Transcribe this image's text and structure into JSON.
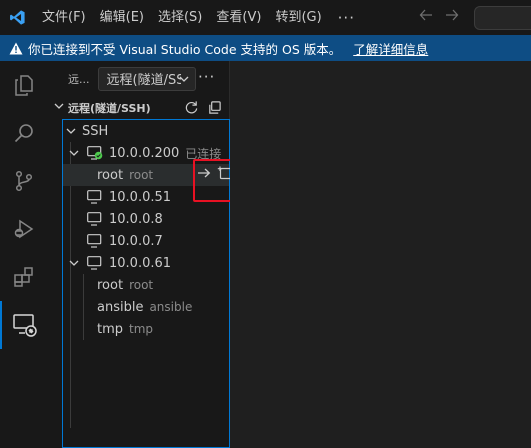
{
  "titlebar": {
    "menu": [
      "文件(F)",
      "编辑(E)",
      "选择(S)",
      "查看(V)",
      "转到(G)"
    ],
    "more": "···"
  },
  "banner": {
    "message": "你已连接到不受 Visual Studio Code 支持的 OS 版本。",
    "link": "了解详细信息"
  },
  "sidebar": {
    "title": "远...",
    "select_value": "远程(隧道/SSH)",
    "more": "···",
    "section_title": "远程(隧道/SSH)"
  },
  "tree": {
    "root_label": "SSH",
    "host1": {
      "name": "10.0.0.200",
      "status": "已连接"
    },
    "host1_children": [
      {
        "label": "root",
        "desc": "root"
      }
    ],
    "other_hosts": [
      "10.0.0.51",
      "10.0.0.8",
      "10.0.0.7"
    ],
    "host2": {
      "name": "10.0.0.61"
    },
    "host2_children": [
      {
        "label": "root",
        "desc": "root"
      },
      {
        "label": "ansible",
        "desc": "ansible"
      },
      {
        "label": "tmp",
        "desc": "tmp"
      }
    ]
  },
  "colors": {
    "accent": "#0078d4",
    "banner": "#0e4d84",
    "connected": "#4ec94e",
    "highlight": "#e81123"
  }
}
